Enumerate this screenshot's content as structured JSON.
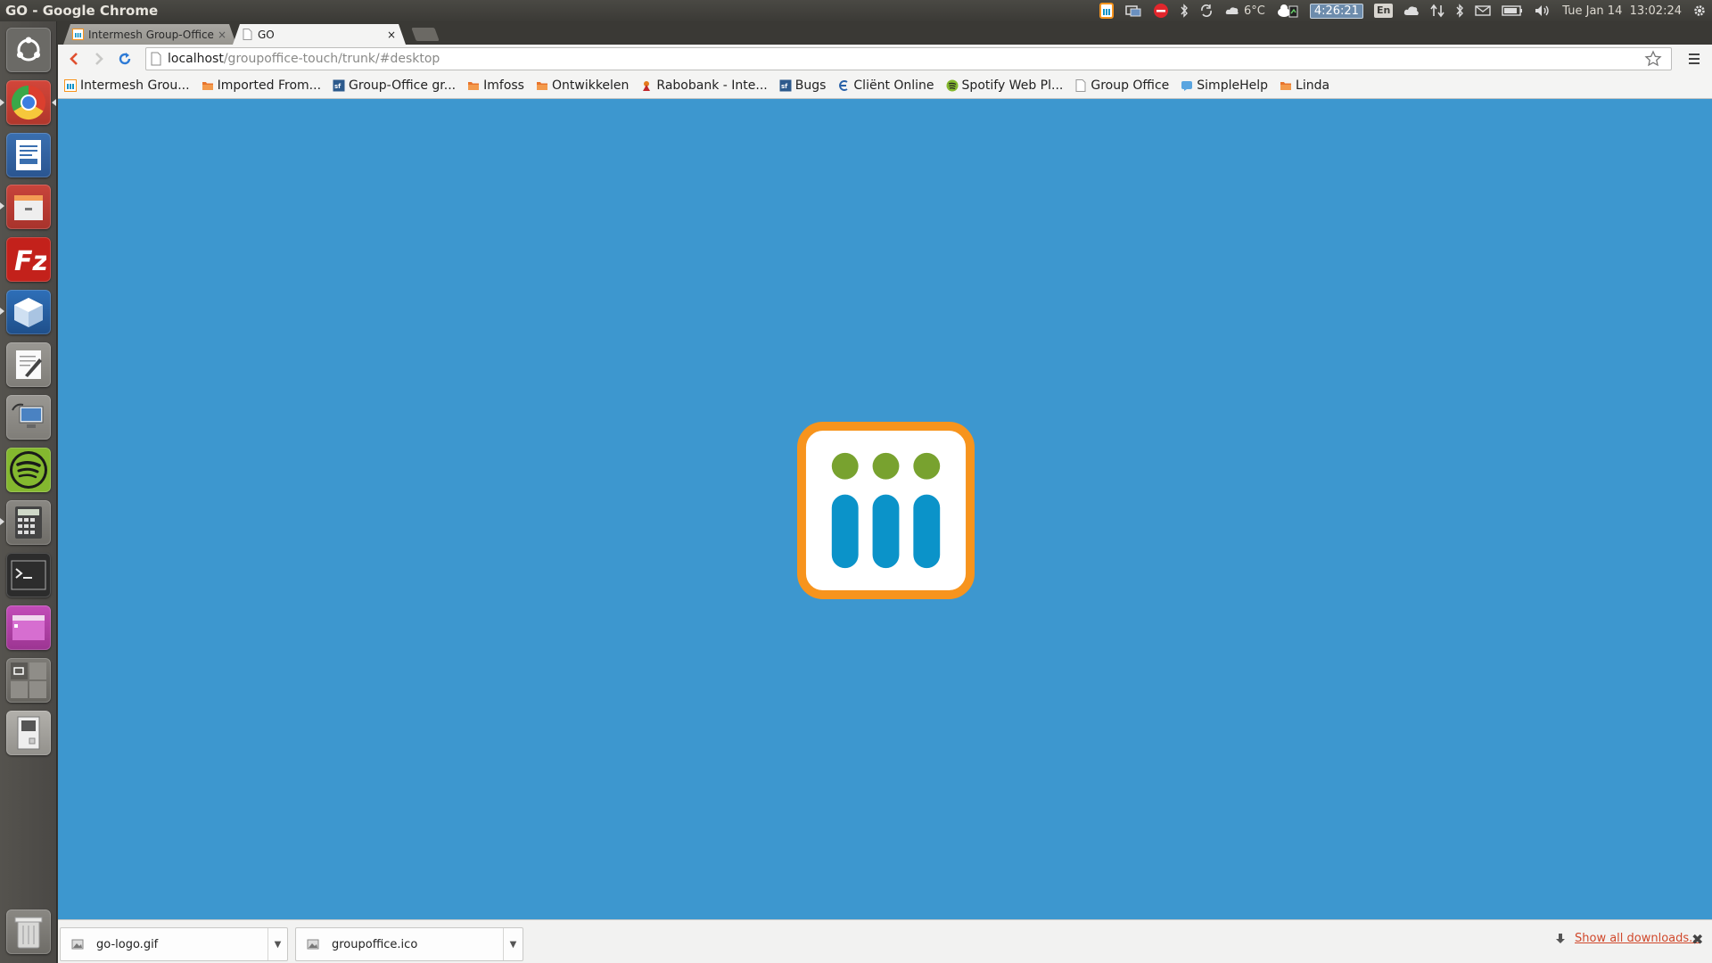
{
  "window": {
    "title": "GO - Google Chrome"
  },
  "panel": {
    "weather": "6°C",
    "timer": "4:26:21",
    "keyboard": "En",
    "datetime": "Tue Jan 14  13:02:24"
  },
  "tabs": [
    {
      "title": "Intermesh Group-Office",
      "close": "×"
    },
    {
      "title": "GO",
      "close": "×"
    }
  ],
  "address": {
    "host": "localhost",
    "path": "/groupoffice-touch/trunk/#desktop"
  },
  "bookmarks": [
    {
      "label": "Intermesh Grou...",
      "icon": "go-favicon"
    },
    {
      "label": "Imported From...",
      "icon": "folder-icon"
    },
    {
      "label": "Group-Office gr...",
      "icon": "sourceforge-icon"
    },
    {
      "label": "Imfoss",
      "icon": "folder-icon"
    },
    {
      "label": "Ontwikkelen",
      "icon": "folder-icon"
    },
    {
      "label": "Rabobank - Inte...",
      "icon": "rabobank-icon"
    },
    {
      "label": "Bugs",
      "icon": "sourceforge-icon"
    },
    {
      "label": "Cliënt Online",
      "icon": "client-online-icon"
    },
    {
      "label": "Spotify Web Pl...",
      "icon": "spotify-icon"
    },
    {
      "label": "Group Office",
      "icon": "page-icon"
    },
    {
      "label": "SimpleHelp",
      "icon": "simplehelp-icon"
    },
    {
      "label": "Linda",
      "icon": "folder-icon"
    }
  ],
  "downloads": {
    "items": [
      {
        "name": "go-logo.gif"
      },
      {
        "name": "groupoffice.ico"
      }
    ],
    "show_all": "Show all downloads...",
    "close": "✖"
  },
  "colors": {
    "content_bg": "#3d97cf",
    "logo_border": "#f7941d",
    "logo_dot": "#78a22f",
    "logo_bar": "#0b93c9"
  }
}
